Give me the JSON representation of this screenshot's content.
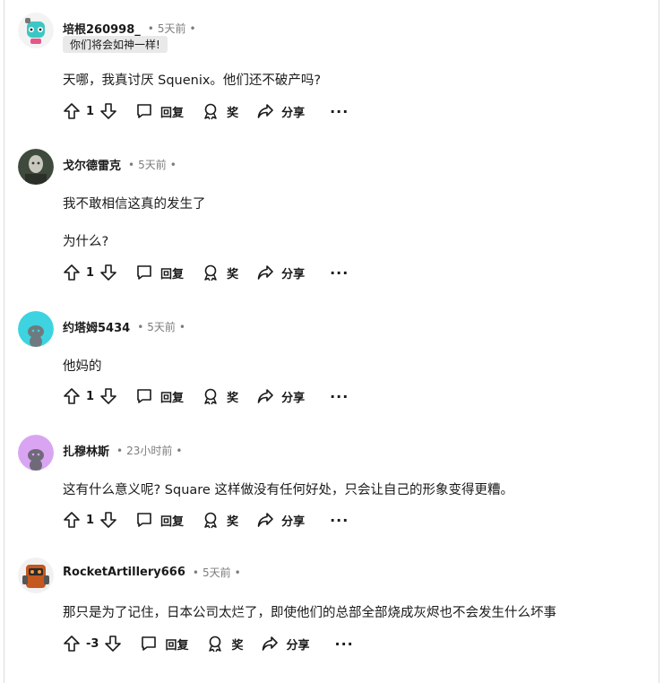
{
  "actions": {
    "reply": "回复",
    "award": "奖",
    "share": "分享",
    "more": "···"
  },
  "comments": [
    {
      "author": "培根260998_",
      "time": "5天前",
      "flair": "你们将会如神一样!",
      "lines": [
        "天哪，我真讨厌 Squenix。他们还不破产吗?"
      ],
      "votes": "1",
      "avatar": "teal-robot-avatar"
    },
    {
      "author": "戈尔德雷克",
      "time": "5天前",
      "lines": [
        "我不敢相信这真的发生了",
        "为什么?"
      ],
      "votes": "1",
      "avatar": "dark-photo-avatar"
    },
    {
      "author": "约塔姆5434",
      "time": "5天前",
      "lines": [
        "他妈的"
      ],
      "votes": "1",
      "avatar": "cyan-snoo-avatar"
    },
    {
      "author": "扎穆林斯",
      "time": "23小时前",
      "lines": [
        "这有什么意义呢? Square 这样做没有任何好处，只会让自己的形象变得更糟。"
      ],
      "votes": "1",
      "avatar": "purple-snoo-avatar"
    },
    {
      "author": "RocketArtillery666",
      "time": "5天前",
      "lines": [
        "那只是为了记住，日本公司太烂了，即使他们的总部全部烧成灰烬也不会发生什么坏事"
      ],
      "votes": "-3",
      "avatar": "robot-armor-avatar"
    }
  ]
}
